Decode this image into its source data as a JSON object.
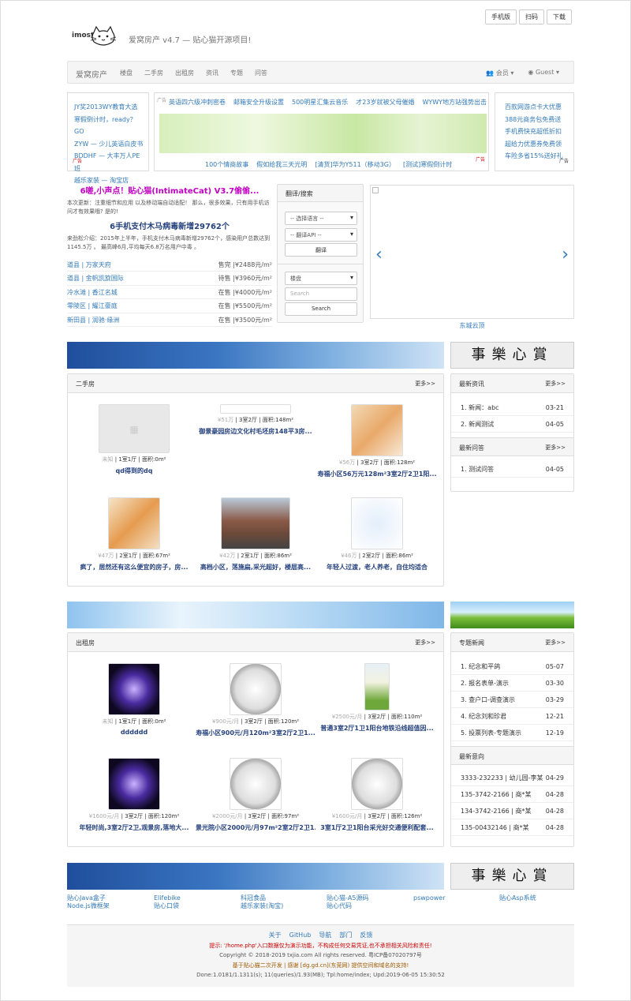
{
  "top_buttons": [
    "手机版",
    "扫码",
    "下载"
  ],
  "logo_text": "imost",
  "site_title": "爱窝房产 v4.7 — 贴心猫开源项目!",
  "nav": {
    "brand": "爱窝房产",
    "items": [
      "楼盘",
      "二手房",
      "出租房",
      "资讯",
      "专题",
      "问答"
    ],
    "member": "会员",
    "guest": "Guest"
  },
  "ads": {
    "tag": "广告",
    "left": [
      "JY奖2013WY教育大选",
      "寒假倒计时，ready？GO",
      "ZYW — 少儿英语白皮书",
      "BDDHF — 大丰万人PE班",
      "越乐家装 — 淘宝店"
    ],
    "top": [
      "英语四六级冲刺密卷",
      "邮箱安全升级设置",
      "500明星汇集云音乐",
      "才23岁就被父母催婚",
      "WYWY地方站强势出击"
    ],
    "bottom": [
      "100个情商故事",
      "假如给我三天光明",
      "[清货]华为Y511（移动3G）",
      "[测试]寒假倒计时"
    ],
    "right": [
      "百款网游点卡大优惠",
      "388元商务包免费送",
      "手机费快充超低折扣",
      "超给力优惠券免费领",
      "车险多省15%送好礼"
    ]
  },
  "news": {
    "headline1": "6嗟,小声点！贴心猫(IntimateCat) V3.7偷偷...",
    "text1": "本次更新：注重细节和应用 以及移动端自动适配！ 那么，很多效果，只有用手机访问才有效果哦? 是的!",
    "headline2": "6手机支付木马病毒新增29762个",
    "text2": "来劲松介绍：2015年上半年，手机支付木马病毒新增29762个，感染用户总数达到1145.5万 。 最高峰6月,平均每天6.8万名用户中毒 。"
  },
  "houses": [
    {
      "name": "道县 | 万家天府",
      "status": "售完 |¥2488元/m²"
    },
    {
      "name": "道县 | 金帆凯旋国际",
      "status": "待售 |¥3960元/m²"
    },
    {
      "name": "冷水滩 | 香江名城",
      "status": "在售 |¥4000元/m²"
    },
    {
      "name": "零陵区 | 耀江豪庭",
      "status": "在售 |¥5500元/m²"
    },
    {
      "name": "新田县 | 润驰·缘洲",
      "status": "在售 |¥3500元/m²"
    }
  ],
  "translate": {
    "title": "翻译/搜索",
    "lang": "-- 选择语言 --",
    "api": "-- 翻译API --",
    "btn": "翻译",
    "type": "楼盘",
    "search_placeholder": "Search",
    "search_btn": "Search"
  },
  "carousel": {
    "caption": "东城云顶",
    "prev": "‹",
    "next": "›"
  },
  "calligraphy": "事樂心賞",
  "more": "更多>>",
  "secondhand": {
    "title": "二手房",
    "items": [
      {
        "price": "未知",
        "info": "| 1室1厅 | 面积:0m²",
        "title": "qd得到的dq"
      },
      {
        "price": "¥51万",
        "info": "| 3室2厅 | 面积:148m²",
        "title": "御景豪园房边文化村毛坯房148平3房..."
      },
      {
        "price": "¥56万",
        "info": "| 3室2厅 | 面积:128m²",
        "title": "寿福小区56万元128m²3室2厅2卫1阳..."
      },
      {
        "price": "¥47万",
        "info": "| 2室1厅 | 面积:67m²",
        "title": "疯了，居然还有这么便宜的房子，房..."
      },
      {
        "price": "¥42万",
        "info": "| 2室1厅 | 面积:86m²",
        "title": "高档小区，荡施扁,采光超好，楼层高..."
      },
      {
        "price": "¥46万",
        "info": "| 2室2厅 | 面积:86m²",
        "title": "年轻人过渡，老人养老，自住均适合"
      }
    ]
  },
  "latest_news": {
    "title": "最新资讯",
    "items": [
      {
        "t": "1. 新闻：abc",
        "d": "03-21"
      },
      {
        "t": "2. 新闻测试",
        "d": "04-05"
      }
    ]
  },
  "latest_qa": {
    "title": "最新问答",
    "items": [
      {
        "t": "1. 测试问答",
        "d": "04-05"
      }
    ]
  },
  "rental": {
    "title": "出租房",
    "items": [
      {
        "price": "未知",
        "info": "| 1室1厅 | 面积:0m²",
        "title": "dddddd"
      },
      {
        "price": "¥900元/月",
        "info": "| 3室2厅 | 面积:120m²",
        "title": "寿福小区900元/月120m²3室2厅2卫1..."
      },
      {
        "price": "¥2500元/月",
        "info": "| 3室2厅 | 面积:110m²",
        "title": "普通3室2厅1卫1阳台地铁沿线超值因..."
      },
      {
        "price": "¥1600元/月",
        "info": "| 3室2厅 | 面积:120m²",
        "title": "年轻时尚,3室2厅2卫,观景房,落地大..."
      },
      {
        "price": "¥2000元/月",
        "info": "| 3室2厅 | 面积:97m²",
        "title": "景光院小区2000元/月97m²2室2厅2卫1..."
      },
      {
        "price": "¥1600元/月",
        "info": "| 3室2厅 | 面积:126m²",
        "title": "3室1厅2卫1阳台采光好交通便利配套..."
      }
    ]
  },
  "topics": {
    "title": "专题新闻",
    "items": [
      {
        "t": "1. 纪念和平鸽",
        "d": "05-07"
      },
      {
        "t": "2. 报名表单-演示",
        "d": "03-30"
      },
      {
        "t": "3. 查户口-调查演示",
        "d": "03-29"
      },
      {
        "t": "4. 纪念刘和珍君",
        "d": "12-21"
      },
      {
        "t": "5. 投票列表-专题演示",
        "d": "12-19"
      }
    ]
  },
  "intent": {
    "title": "最新意向",
    "items": [
      {
        "t": "3333-232233 | 幼儿园-李某",
        "d": "04-29"
      },
      {
        "t": "135-3742-2166 | 商*某",
        "d": "04-28"
      },
      {
        "t": "134-3742-2166 | 商*某",
        "d": "04-28"
      },
      {
        "t": "135-00432146 | 商*某",
        "d": "04-28"
      }
    ]
  },
  "friend_links": [
    [
      "贴心Java盒子",
      "Node.js微框架"
    ],
    [
      "Elifebike",
      "贴心口袋"
    ],
    [
      "科冠食品",
      "越乐家装(淘宝)"
    ],
    [
      "贴心猫-A5源码",
      "贴心代码"
    ],
    [
      "pswpower",
      ""
    ],
    [
      "贴心Asp系统",
      ""
    ]
  ],
  "footer": {
    "nav": [
      "关于",
      "GitHub",
      "导航",
      "部门",
      "反馈"
    ],
    "warn": "提示: '/home.php'入口数据仅为演示功能，不构成任何交易凭证,也不承担相关风险和责任!",
    "copyright": "Copyright © 2018-2019 txjia.com All rights reserved. 粤ICP备07020797号",
    "powered": "基于贴心猫二次开发 | 感谢 [dg.gd.cn](东莞网) 提供空间和域名的支持!",
    "debug": "Done:1.0181/1.1311(s); 11(queries)/1.93(MB); Tpl:home/index; Upd:2019-06-05 15:30:52"
  }
}
